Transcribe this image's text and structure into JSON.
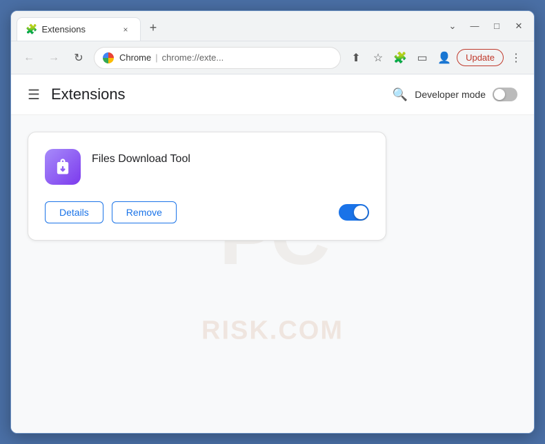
{
  "browser": {
    "tab": {
      "icon": "🧩",
      "title": "Extensions",
      "close_label": "×"
    },
    "new_tab_label": "+",
    "window_controls": {
      "minimize": "—",
      "maximize": "□",
      "close": "✕",
      "chevron": "⌄"
    },
    "address_bar": {
      "back_label": "←",
      "forward_label": "→",
      "reload_label": "↻",
      "site_name": "Chrome",
      "url_divider": "|",
      "url_rest": "chrome://exte...",
      "share_label": "⬆",
      "star_label": "☆",
      "extensions_label": "🧩",
      "sidebar_label": "▭",
      "account_label": "👤",
      "update_label": "Update",
      "menu_label": "⋮"
    }
  },
  "page": {
    "menu_label": "☰",
    "title": "Extensions",
    "search_label": "🔍",
    "dev_mode_label": "Developer mode"
  },
  "extension": {
    "name": "Files Download Tool",
    "details_label": "Details",
    "remove_label": "Remove"
  },
  "watermark": {
    "line1": "PC",
    "line2": "RISK.COM"
  }
}
